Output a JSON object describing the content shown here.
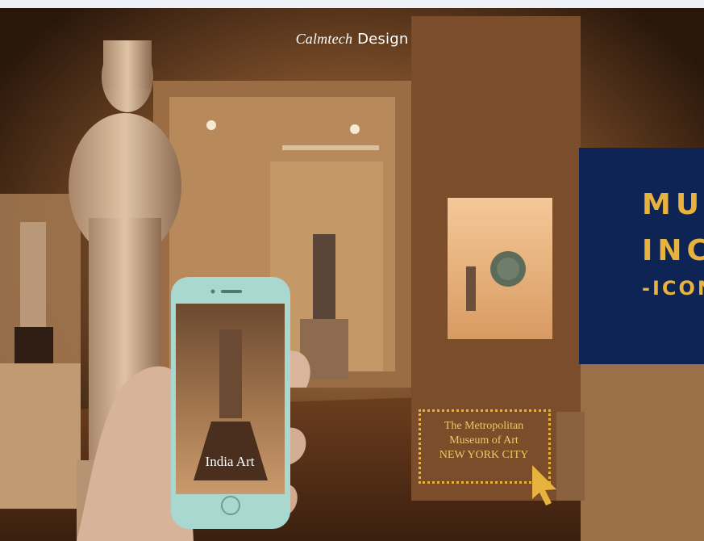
{
  "brand": {
    "italic": "Calmtech",
    "plain": "Design"
  },
  "panel": {
    "line1": "MUSEUM",
    "line2": "INCLUSIVE",
    "line3": "-ICONOGRAPHY"
  },
  "museum_label": {
    "line1": "The Metropolitan",
    "line2": "Museum of Art",
    "line3": "NEW YORK CITY"
  },
  "phone": {
    "screen_title": "India Art"
  },
  "colors": {
    "accent": "#e8b23e",
    "panel": "#0e2454",
    "phone_body": "#a8d8d0"
  }
}
